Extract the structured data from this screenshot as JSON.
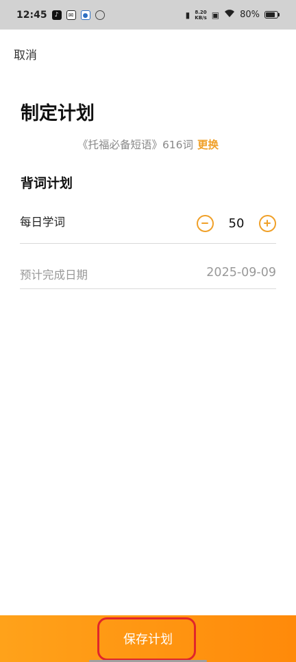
{
  "status_bar": {
    "time": "12:45",
    "net_speed_value": "8.20",
    "net_speed_unit": "KB/s",
    "battery": "80%",
    "app_icons": [
      "tiktok-icon",
      "mail-icon",
      "notification-app-icon",
      "sync-icon"
    ],
    "right_icons": [
      "vibrate-icon",
      "sim-icon",
      "wifi-icon",
      "battery-icon"
    ]
  },
  "header": {
    "cancel_label": "取消"
  },
  "page": {
    "title": "制定计划",
    "book_name": "《托福必备短语》616词",
    "change_label": "更换"
  },
  "plan": {
    "section_title": "背词计划",
    "daily_label": "每日学词",
    "daily_value": "50",
    "finish_label": "预计完成日期",
    "finish_date": "2025-09-09"
  },
  "footer": {
    "save_label": "保存计划"
  },
  "colors": {
    "accent": "#f0a028",
    "save_bar_start": "#ffa21a",
    "save_bar_end": "#ff8a0a",
    "highlight": "#e0262b"
  }
}
